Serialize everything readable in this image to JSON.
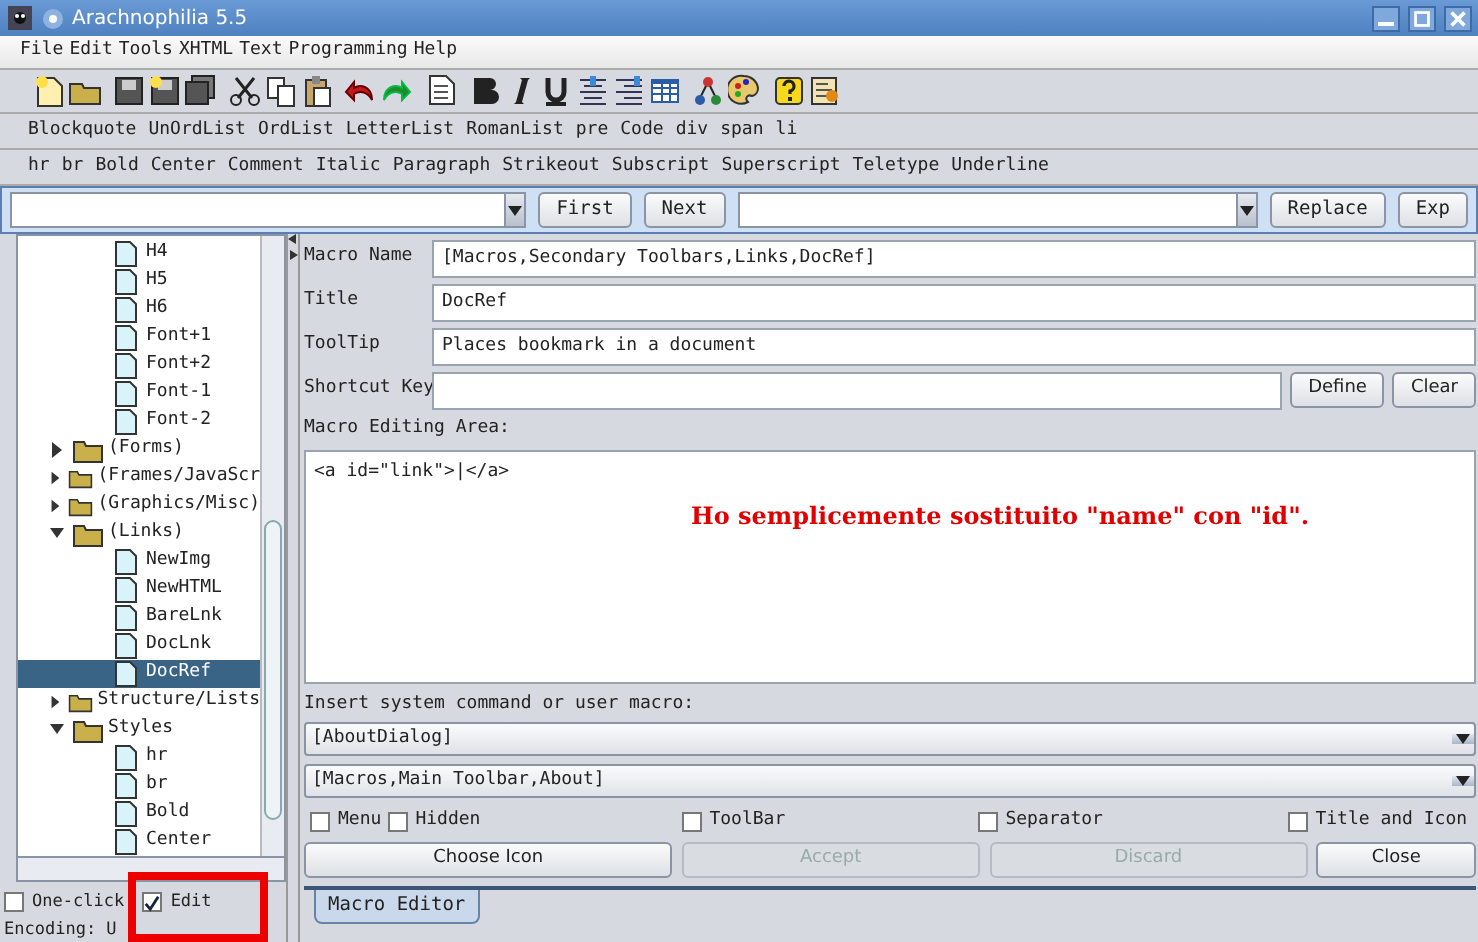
{
  "window": {
    "title": "Arachnophilia 5.5"
  },
  "menu": [
    "File",
    "Edit",
    "Tools",
    "XHTML",
    "Text",
    "Programming",
    "Help"
  ],
  "toolbar_rows": [
    [
      "Blockquote",
      "UnOrdList",
      "OrdList",
      "LetterList",
      "RomanList",
      "pre",
      "Code",
      "div",
      "span",
      "li"
    ],
    [
      "hr",
      "br",
      "Bold",
      "Center",
      "Comment",
      "Italic",
      "Paragraph",
      "Strikeout",
      "Subscript",
      "Superscript",
      "Teletype",
      "Underline"
    ]
  ],
  "search_bar": {
    "buttons": [
      "First",
      "Next"
    ],
    "replace_buttons": [
      "Replace",
      "Exp"
    ]
  },
  "tree": [
    {
      "children": [
        {
          "label": "H4",
          "kind": "file",
          "selected": false
        },
        {
          "label": "H5",
          "kind": "file",
          "selected": false
        },
        {
          "label": "H6",
          "kind": "file",
          "selected": false
        },
        {
          "label": "Font+1",
          "kind": "file",
          "selected": false
        },
        {
          "label": "Font+2",
          "kind": "file",
          "selected": false
        },
        {
          "label": "Font-1",
          "kind": "file",
          "selected": false
        },
        {
          "label": "Font-2",
          "kind": "file",
          "selected": false
        }
      ]
    },
    {
      "label": "(Forms)",
      "kind": "folder",
      "expanded": false,
      "selected": false
    },
    {
      "label": "(Frames/JavaScr",
      "kind": "folder",
      "expanded": false,
      "selected": false
    },
    {
      "label": "(Graphics/Misc)",
      "kind": "folder",
      "expanded": false,
      "selected": false
    },
    {
      "label": "(Links)",
      "kind": "folder",
      "expanded": true,
      "selected": false,
      "children": [
        {
          "label": "NewImg",
          "kind": "file",
          "selected": false
        },
        {
          "label": "NewHTML",
          "kind": "file",
          "selected": false
        },
        {
          "label": "BareLnk",
          "kind": "file",
          "selected": false
        },
        {
          "label": "DocLnk",
          "kind": "file",
          "selected": false
        },
        {
          "label": "DocRef",
          "kind": "file",
          "selected": true
        }
      ]
    },
    {
      "label": "Structure/Lists",
      "kind": "folder",
      "expanded": false,
      "selected": false
    },
    {
      "label": "Styles",
      "kind": "folder",
      "expanded": true,
      "selected": false,
      "children": [
        {
          "label": "hr",
          "kind": "file",
          "selected": false
        },
        {
          "label": "br",
          "kind": "file",
          "selected": false
        },
        {
          "label": "Bold",
          "kind": "file",
          "selected": false
        },
        {
          "label": "Center",
          "kind": "file",
          "selected": false
        }
      ]
    }
  ],
  "left_options": [
    {
      "label": "One-click",
      "checked": false
    },
    {
      "label": "Edit",
      "checked": true
    }
  ],
  "status_bar": "Encoding: U",
  "macro_editor": {
    "fields": [
      {
        "label": "Macro Name",
        "value": "[Macros,Secondary Toolbars,Links,DocRef]"
      },
      {
        "label": "Title",
        "value": "DocRef"
      },
      {
        "label": "ToolTip",
        "value": "Places bookmark in a document"
      }
    ],
    "shortcut": {
      "label": "Shortcut Key",
      "buttons": [
        "Define",
        "Clear"
      ]
    },
    "editing_label": "Macro Editing Area:",
    "editing_text": "<a id=\"link\">|</a>",
    "annotation": "Ho semplicemente sostituito \"name\" con \"id\".",
    "insert_label": "Insert system command or user macro:",
    "dropdowns": [
      "[AboutDialog]",
      "[Macros,Main Toolbar,About]"
    ],
    "checkboxes": [
      {
        "label": "Menu",
        "checked": false
      },
      {
        "label": "Hidden",
        "checked": false
      },
      {
        "label": "ToolBar",
        "checked": false
      },
      {
        "label": "Separator",
        "checked": false
      },
      {
        "label": "Title and Icon",
        "checked": false
      }
    ],
    "buttons": [
      {
        "label": "Choose Icon",
        "disabled": false
      },
      {
        "label": "Accept",
        "disabled": true
      },
      {
        "label": "Discard",
        "disabled": true
      },
      {
        "label": "Close",
        "disabled": false
      }
    ],
    "tabs": [
      {
        "label": "Macro Editor",
        "selected": true
      }
    ]
  }
}
